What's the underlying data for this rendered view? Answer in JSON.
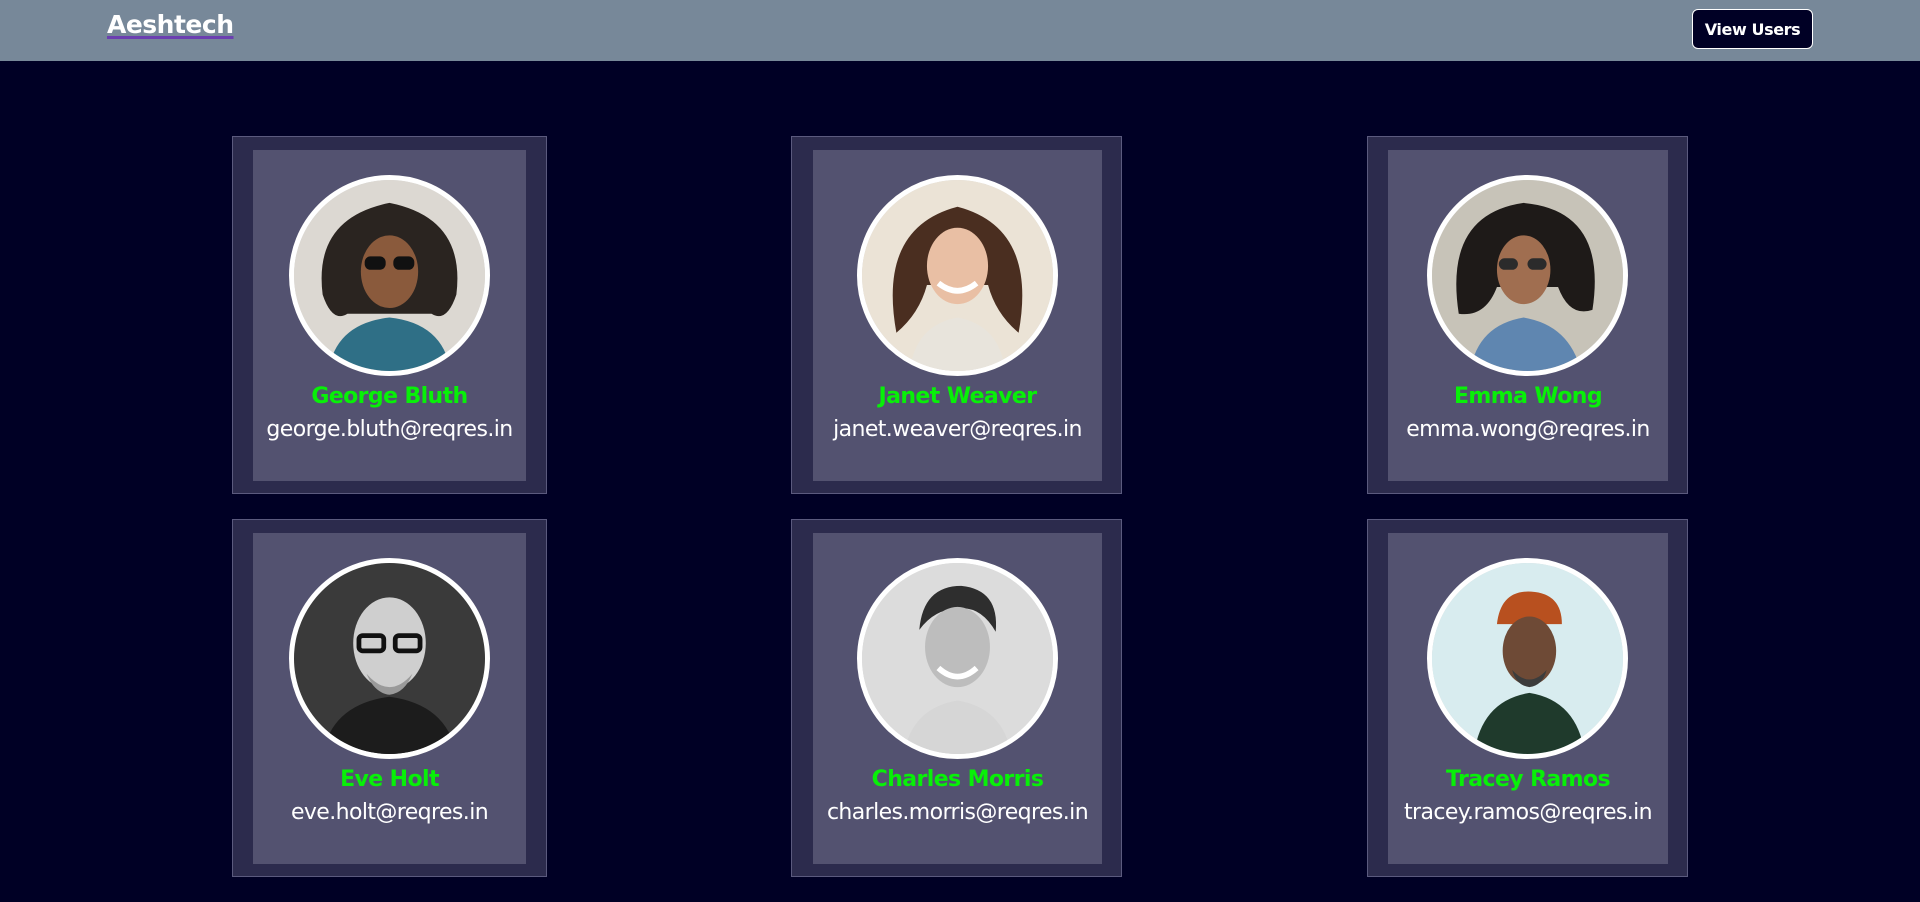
{
  "navbar": {
    "brand": "Aeshtech",
    "view_users_label": "View Users"
  },
  "users": [
    {
      "name": "George Bluth",
      "email": "george.bluth@reqres.in"
    },
    {
      "name": "Janet Weaver",
      "email": "janet.weaver@reqres.in"
    },
    {
      "name": "Emma Wong",
      "email": "emma.wong@reqres.in"
    },
    {
      "name": "Eve Holt",
      "email": "eve.holt@reqres.in"
    },
    {
      "name": "Charles Morris",
      "email": "charles.morris@reqres.in"
    },
    {
      "name": "Tracey Ramos",
      "email": "tracey.ramos@reqres.in"
    }
  ],
  "colors": {
    "page_background": "#000025",
    "navbar": "#778899",
    "card_outer": "#2c2b4d",
    "card_inner": "#535270",
    "name_text": "#08f008",
    "email_text": "#ffffff"
  }
}
